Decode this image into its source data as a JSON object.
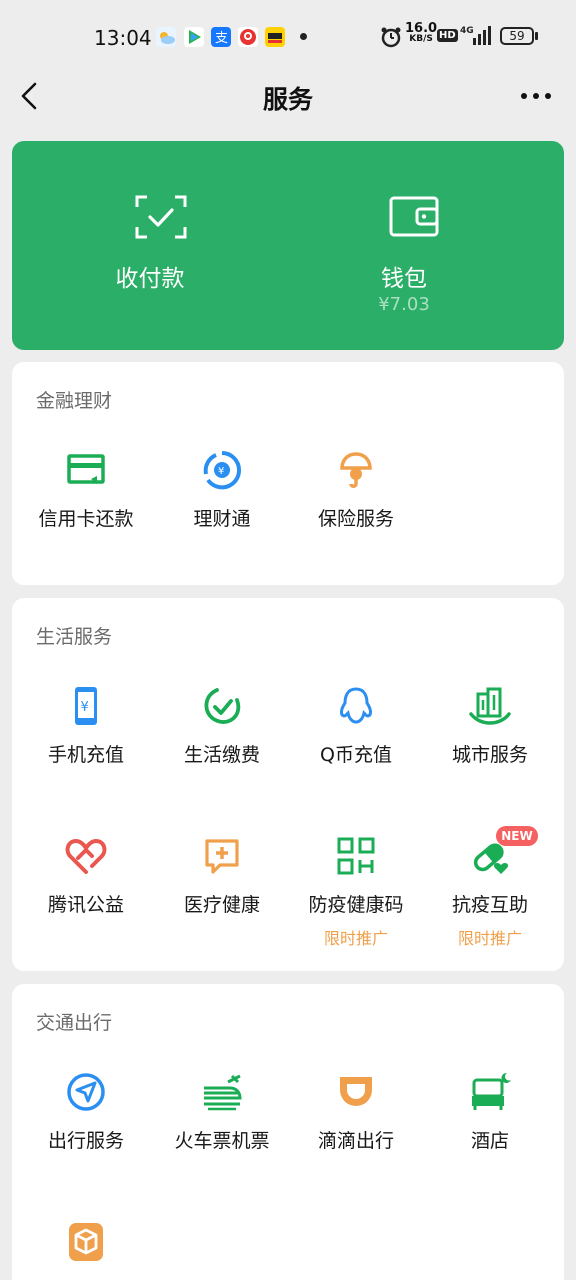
{
  "status_bar": {
    "time": "13:04",
    "net_speed_value": "16.0",
    "net_speed_unit": "KB/S",
    "hd_label": "HD",
    "network_type": "4G",
    "battery": "59"
  },
  "nav": {
    "title": "服务",
    "back_icon": "chevron-left-icon",
    "more_icon": "more-dots-icon"
  },
  "hero": {
    "pay": {
      "label": "收付款",
      "icon": "scan-check-icon"
    },
    "wallet": {
      "label": "钱包",
      "balance": "¥7.03",
      "icon": "wallet-icon"
    }
  },
  "finance": {
    "title": "金融理财",
    "items": [
      {
        "label": "信用卡还款",
        "icon": "credit-card-icon"
      },
      {
        "label": "理财通",
        "icon": "wealth-icon"
      },
      {
        "label": "保险服务",
        "icon": "insurance-icon"
      }
    ]
  },
  "life": {
    "title": "生活服务",
    "items": [
      {
        "label": "手机充值",
        "icon": "phone-recharge-icon"
      },
      {
        "label": "生活缴费",
        "icon": "bill-pay-icon"
      },
      {
        "label": "Q币充值",
        "icon": "qq-coin-icon"
      },
      {
        "label": "城市服务",
        "icon": "city-icon"
      },
      {
        "label": "腾讯公益",
        "icon": "charity-heart-icon"
      },
      {
        "label": "医疗健康",
        "icon": "medical-icon"
      },
      {
        "label": "防疫健康码",
        "icon": "health-code-icon",
        "tag": "限时推广"
      },
      {
        "label": "抗疫互助",
        "icon": "pill-icon",
        "tag": "限时推广",
        "badge": "NEW"
      }
    ]
  },
  "transport": {
    "title": "交通出行",
    "items": [
      {
        "label": "出行服务",
        "icon": "navigation-icon"
      },
      {
        "label": "火车票机票",
        "icon": "train-plane-icon"
      },
      {
        "label": "滴滴出行",
        "icon": "didi-icon"
      },
      {
        "label": "酒店",
        "icon": "hotel-bed-icon"
      },
      {
        "label": "",
        "icon": "package-icon"
      }
    ]
  },
  "colors": {
    "accent_green": "#2bae67",
    "icon_green": "#1aad55",
    "icon_blue": "#2b8ff2",
    "icon_orange": "#f0a04b",
    "icon_red": "#e9574f",
    "promo_orange": "#f0a04b",
    "background": "#ededed"
  }
}
